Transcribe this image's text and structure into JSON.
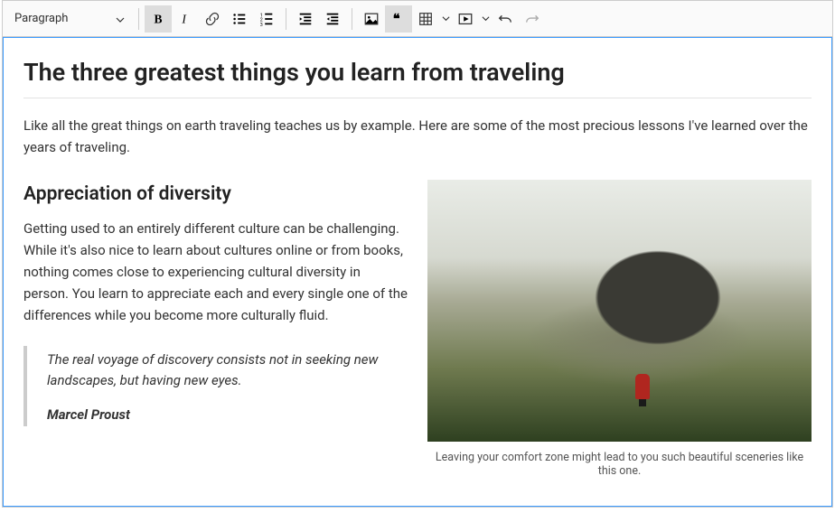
{
  "toolbar": {
    "style_selector": {
      "value": "Paragraph"
    }
  },
  "document": {
    "title": "The three greatest things you learn from traveling",
    "intro": "Like all the great things on earth traveling teaches us by example. Here are some of the most precious lessons I've learned over the years of traveling.",
    "section": {
      "heading": "Appreciation of diversity",
      "body": "Getting used to an entirely different culture can be challenging. While it's also nice to learn about cultures online or from books, nothing comes close to experiencing cultural diversity in person. You learn to appreciate each and every single one of the differences while you become more culturally fluid."
    },
    "blockquote": {
      "text": "The real voyage of discovery consists not in seeking new landscapes, but having new eyes.",
      "author": "Marcel Proust"
    },
    "figure": {
      "caption": "Leaving your comfort zone might lead to you such beautiful sceneries like this one."
    }
  }
}
